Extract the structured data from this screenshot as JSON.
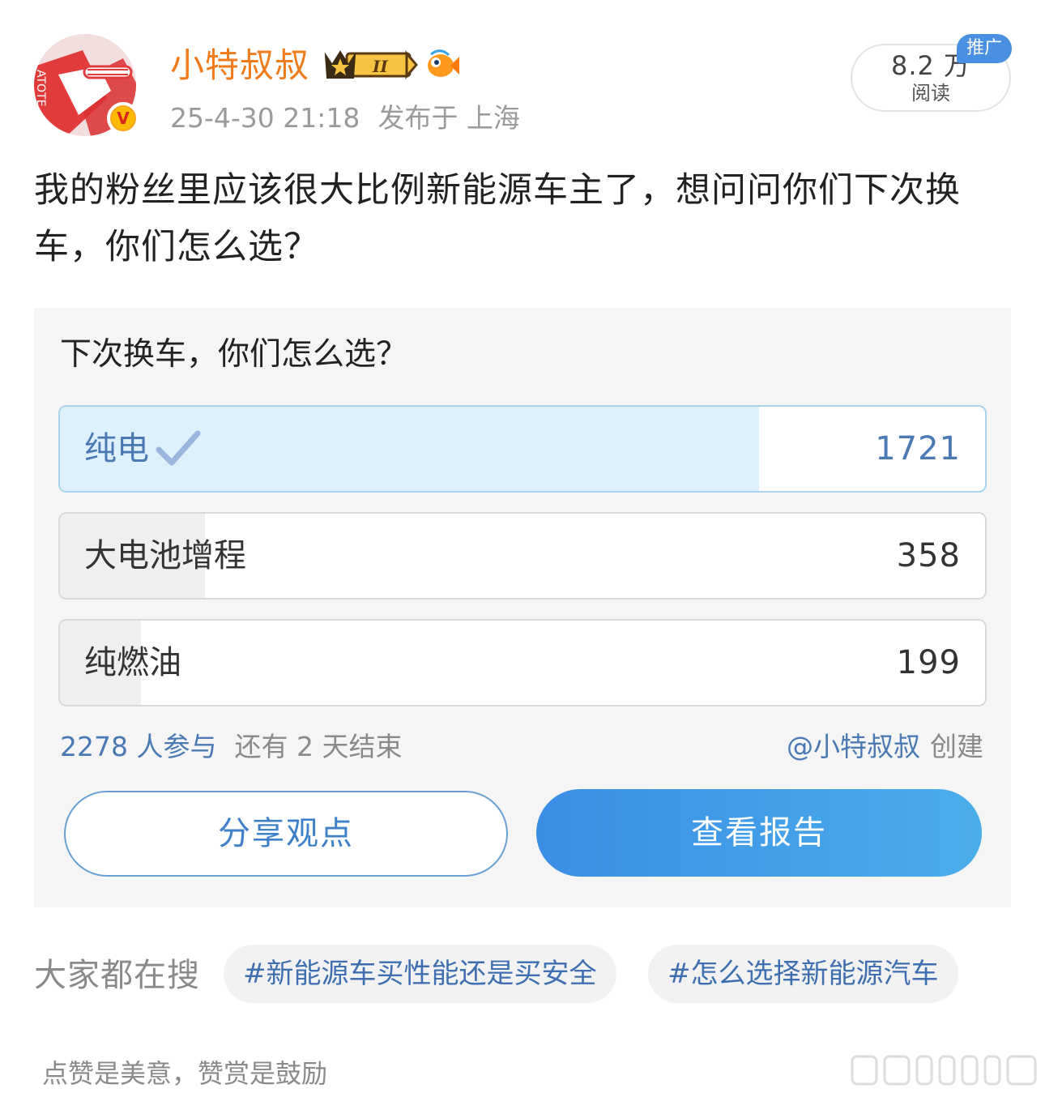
{
  "header": {
    "user_name": "小特叔叔",
    "post_time": "25-4-30 21:18",
    "location": "发布于 上海",
    "reads": {
      "count": "8.2 万",
      "label": "阅读"
    },
    "promo_tag": "推广",
    "avatar_text": "ATOTE"
  },
  "post": {
    "text": "我的粉丝里应该很大比例新能源车主了，想问问你们下次换车，你们怎么选？"
  },
  "poll": {
    "title": "下次换车，你们怎么选？",
    "options": [
      {
        "label": "纯电",
        "count": "1721",
        "votes": 1721,
        "selected": true
      },
      {
        "label": "大电池增程",
        "count": "358",
        "votes": 358,
        "selected": false
      },
      {
        "label": "纯燃油",
        "count": "199",
        "votes": 199,
        "selected": false
      }
    ],
    "participants": "2278 人参与",
    "remaining": "还有 2 天结束",
    "creator": "@小特叔叔",
    "creator_suffix": "创建",
    "share_label": "分享观点",
    "report_label": "查看报告"
  },
  "search": {
    "label": "大家都在搜",
    "topics": [
      "#新能源车买性能还是买安全",
      "#怎么选择新能源汽车"
    ]
  },
  "footer": {
    "reward_text": "点赞是美意，赞赏是鼓励"
  },
  "colors": {
    "username": "#f07b1a",
    "link_blue": "#4a79b3",
    "selected_fill": "#ddf0fb",
    "button_gradient_start": "#3b8de6",
    "button_gradient_end": "#4aaeea"
  },
  "icons": [
    "avatar",
    "verified-badge",
    "crown-level-badge",
    "fish-badge",
    "check-icon",
    "watermark-logo"
  ]
}
